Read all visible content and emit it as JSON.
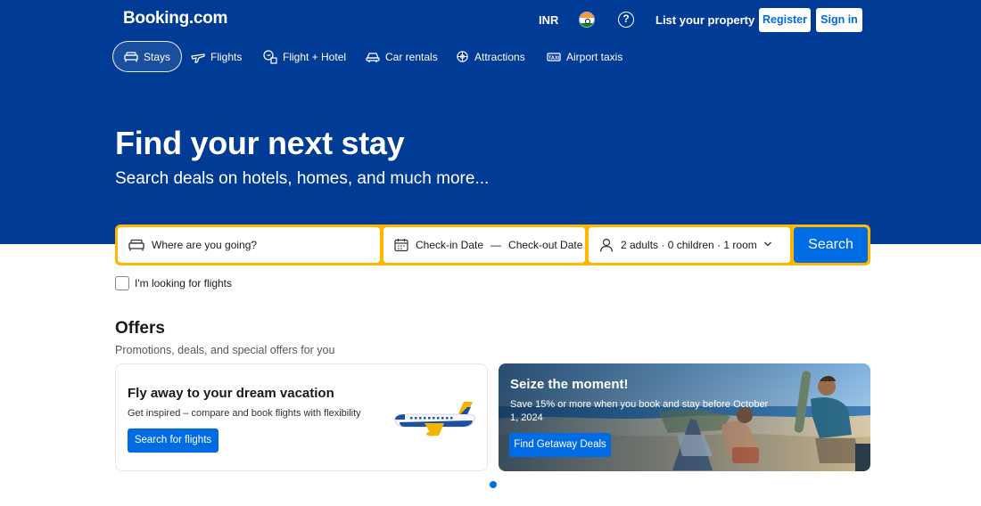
{
  "header": {
    "logo": "Booking.com",
    "currency": "INR",
    "list_property": "List your property",
    "register": "Register",
    "sign_in": "Sign in"
  },
  "nav": {
    "items": [
      {
        "label": "Stays",
        "icon": "bed-icon",
        "active": true
      },
      {
        "label": "Flights",
        "icon": "plane-icon",
        "active": false
      },
      {
        "label": "Flight + Hotel",
        "icon": "flight-hotel-icon",
        "active": false
      },
      {
        "label": "Car rentals",
        "icon": "car-icon",
        "active": false
      },
      {
        "label": "Attractions",
        "icon": "attractions-icon",
        "active": false
      },
      {
        "label": "Airport taxis",
        "icon": "taxi-icon",
        "active": false
      }
    ]
  },
  "hero": {
    "title": "Find your next stay",
    "subtitle": "Search deals on hotels, homes, and much more..."
  },
  "search": {
    "destination_placeholder": "Where are you going?",
    "checkin": "Check-in Date",
    "dash": "—",
    "checkout": "Check-out Date",
    "guests": "2 adults · 0 children · 1 room",
    "button": "Search",
    "flights_checkbox": "I'm looking for flights"
  },
  "offers": {
    "title": "Offers",
    "subtitle": "Promotions, deals, and special offers for you",
    "cards": [
      {
        "title": "Fly away to your dream vacation",
        "description": "Get inspired – compare and book flights with flexibility",
        "button": "Search for flights"
      },
      {
        "title": "Seize the moment!",
        "description": "Save 15% or more when you book and stay before October 1, 2024",
        "button": "Find Getaway Deals"
      }
    ]
  },
  "colors": {
    "brand_blue": "#003b95",
    "action_blue": "#006ce4",
    "search_border": "#ffb700"
  }
}
